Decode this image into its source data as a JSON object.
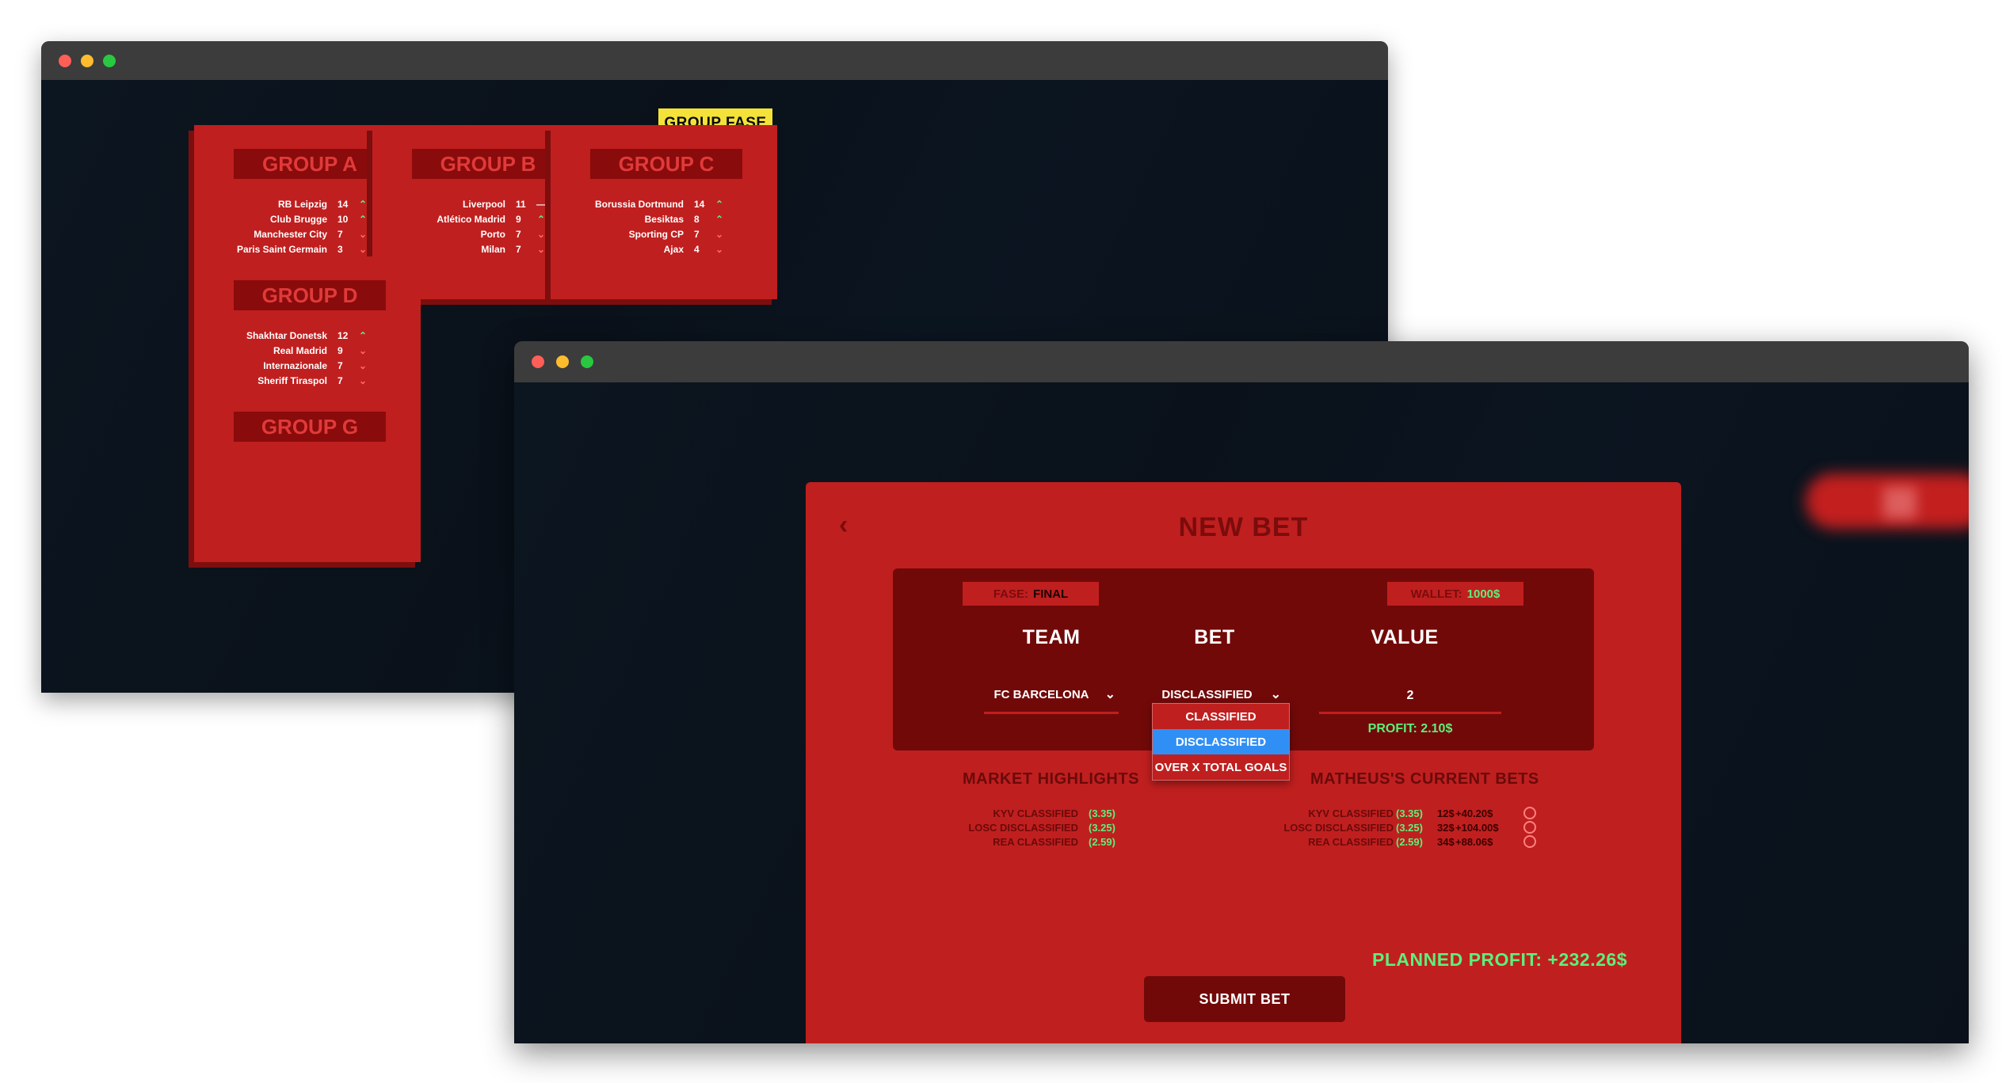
{
  "back_window": {
    "phase_badge": "GROUP FASE",
    "groups": [
      {
        "title": "GROUP A",
        "rows": [
          {
            "team": "RB Leipzig",
            "pts": "14",
            "trend": "up"
          },
          {
            "team": "Club Brugge",
            "pts": "10",
            "trend": "up"
          },
          {
            "team": "Manchester City",
            "pts": "7",
            "trend": "down"
          },
          {
            "team": "Paris Saint Germain",
            "pts": "3",
            "trend": "down"
          }
        ]
      },
      {
        "title": "GROUP B",
        "rows": [
          {
            "team": "Liverpool",
            "pts": "11",
            "trend": "same"
          },
          {
            "team": "Atlético Madrid",
            "pts": "9",
            "trend": "up"
          },
          {
            "team": "Porto",
            "pts": "7",
            "trend": "down"
          },
          {
            "team": "Milan",
            "pts": "7",
            "trend": "down"
          }
        ]
      },
      {
        "title": "GROUP C",
        "rows": [
          {
            "team": "Borussia Dortmund",
            "pts": "14",
            "trend": "up"
          },
          {
            "team": "Besiktas",
            "pts": "8",
            "trend": "up"
          },
          {
            "team": "Sporting CP",
            "pts": "7",
            "trend": "down"
          },
          {
            "team": "Ajax",
            "pts": "4",
            "trend": "down"
          }
        ]
      },
      {
        "title": "GROUP D",
        "rows": [
          {
            "team": "Shakhtar Donetsk",
            "pts": "12",
            "trend": "up"
          },
          {
            "team": "Real Madrid",
            "pts": "9",
            "trend": "down"
          },
          {
            "team": "Internazionale",
            "pts": "7",
            "trend": "down"
          },
          {
            "team": "Sheriff Tiraspol",
            "pts": "7",
            "trend": "down"
          }
        ]
      },
      {
        "title": "GROUP G",
        "rows": []
      }
    ]
  },
  "icons": {
    "up": "chevron-up-icon",
    "down": "chevron-down-icon",
    "same": "dash-icon"
  },
  "trend_glyphs": {
    "up": "⌃",
    "down": "⌄",
    "same": "—"
  },
  "new_bet": {
    "title": "NEW BET",
    "back_glyph": "‹",
    "phase_label": "FASE:",
    "phase_value": "FINAL",
    "wallet_label": "WALLET:",
    "wallet_value": "1000$",
    "col_team": "TEAM",
    "col_bet": "BET",
    "col_value": "VALUE",
    "team_selected": "FC BARCELONA",
    "bet_selected": "DISCLASSIFIED",
    "chevron_glyph": "⌄",
    "value_input": "2",
    "profit_line": "PROFIT: 2.10$",
    "bet_options": [
      "CLASSIFIED",
      "DISCLASSIFIED",
      "OVER X TOTAL GOALS"
    ],
    "selected_option_index": 1,
    "market_title": "MARKET HIGHLIGHTS",
    "market": [
      {
        "label": "KYV CLASSIFIED",
        "odd": "(3.35)"
      },
      {
        "label": "LOSC DISCLASSIFIED",
        "odd": "(3.25)"
      },
      {
        "label": "REA CLASSIFIED",
        "odd": "(2.59)"
      }
    ],
    "current_title": "MATHEUS'S CURRENT BETS",
    "current_bets": [
      {
        "label": "KYV CLASSIFIED",
        "odd": "(3.35)",
        "stake": "12$",
        "gain": "+40.20$"
      },
      {
        "label": "LOSC DISCLASSIFIED",
        "odd": "(3.25)",
        "stake": "32$",
        "gain": "+104.00$"
      },
      {
        "label": "REA CLASSIFIED",
        "odd": "(2.59)",
        "stake": "34$",
        "gain": "+88.06$"
      }
    ],
    "planned_profit": "PLANNED PROFIT: +232.26$",
    "submit_label": "SUBMIT BET"
  },
  "colors": {
    "panel_red": "#c01f1f",
    "dark_red": "#720909",
    "positive_green": "#5cf07a",
    "badge_yellow": "#f4e23a",
    "selected_blue": "#2f8ff5",
    "background": "#0a111a"
  }
}
